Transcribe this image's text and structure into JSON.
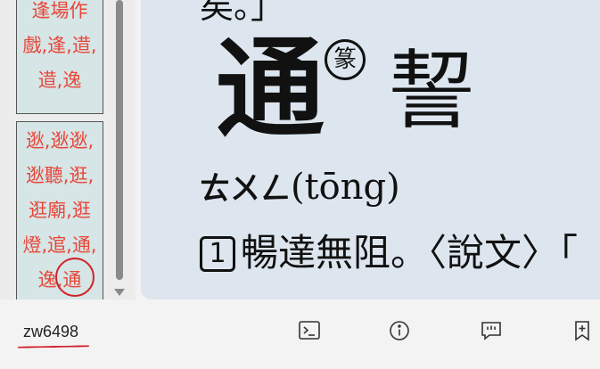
{
  "sidebar": {
    "cell1": {
      "lines": [
        "逢場作",
        "戲,逢,逪,",
        "逪,逸"
      ]
    },
    "cell2": {
      "lines": [
        "逖,逖逖,",
        "逖聽,逛,",
        "逛廟,逛",
        "燈,逭,通,",
        "逸,"
      ],
      "highlight": "通"
    }
  },
  "entry": {
    "prev_text": "矣。」",
    "head_char": "通",
    "seal_label": "篆",
    "seal_char": "䛚",
    "bopomofo": "ㄊㄨㄥ",
    "pinyin": "(tōng)",
    "def_num": "1",
    "def_text": "暢達無阻。〈說文〉「"
  },
  "bottombar": {
    "code": "zw6498"
  },
  "icons": {
    "terminal": "terminal-icon",
    "info": "info-icon",
    "feedback": "feedback-icon",
    "bookmark": "bookmark-add-icon"
  },
  "colors": {
    "accent_red": "#d0202a",
    "link_red": "#e8463a",
    "cell_bg": "#d6e5e5",
    "content_bg": "#dde6ef"
  }
}
